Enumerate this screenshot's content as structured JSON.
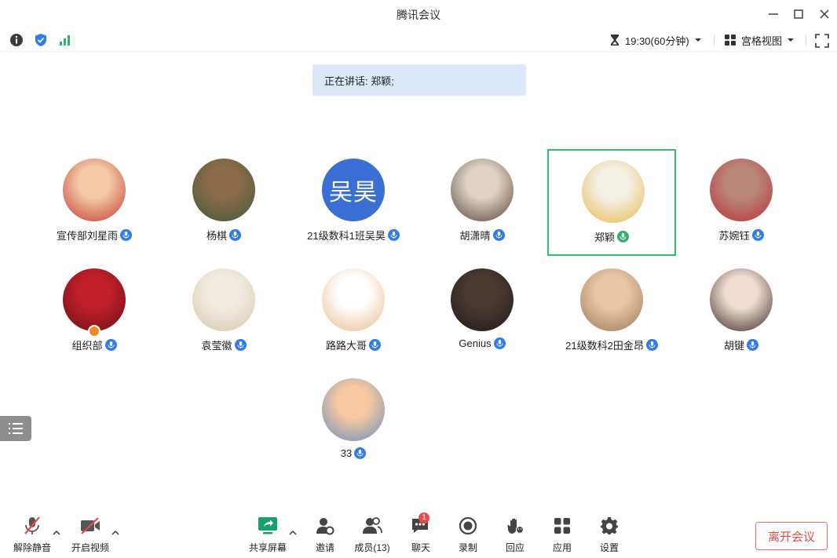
{
  "window": {
    "title": "腾讯会议"
  },
  "infobar": {
    "timer": "19:30(60分钟)",
    "view_label": "宫格视图"
  },
  "speaking_banner": "正在讲话: 郑颖;",
  "participants": [
    {
      "name": "宣传部刘星雨",
      "avatar_colors": [
        "#f3c9a8",
        "#c0392b"
      ]
    },
    {
      "name": "杨棋",
      "avatar_colors": [
        "#8b6b4a",
        "#3e5a3a"
      ]
    },
    {
      "name": "21级数科1班吴昊",
      "avatar_text": "吴昊"
    },
    {
      "name": "胡潇晴",
      "avatar_colors": [
        "#ddd2c4",
        "#5a4438"
      ]
    },
    {
      "name": "郑颖",
      "avatar_colors": [
        "#f3f0e6",
        "#e8b84a"
      ]
    },
    {
      "name": "苏婉钰",
      "avatar_colors": [
        "#b78778",
        "#c02f3a"
      ]
    },
    {
      "name": "组织部",
      "avatar_colors": [
        "#c0202a",
        "#6a0f14"
      ]
    },
    {
      "name": "袁莹徽",
      "avatar_colors": [
        "#f2ece2",
        "#d8c7a8"
      ]
    },
    {
      "name": "路路大哥",
      "avatar_colors": [
        "#ffffff",
        "#e6b98a"
      ]
    },
    {
      "name": "Genius",
      "avatar_colors": [
        "#4a3a32",
        "#1d1a1a"
      ]
    },
    {
      "name": "21级数科2田金昂",
      "avatar_colors": [
        "#e9c7a6",
        "#9a7a5c"
      ]
    },
    {
      "name": "胡键",
      "avatar_colors": [
        "#f0dcd2",
        "#3b2a26"
      ]
    },
    {
      "name": "33",
      "avatar_colors": [
        "#f6c9a0",
        "#6a8fbf"
      ]
    }
  ],
  "active_speaker_index": 4,
  "toolbar": {
    "unmute": "解除静音",
    "start_video": "开启视频",
    "share_screen": "共享屏幕",
    "invite": "邀请",
    "members": "成员(13)",
    "chat": "聊天",
    "chat_badge": "1",
    "record": "录制",
    "reactions": "回应",
    "apps": "应用",
    "settings": "设置",
    "leave": "离开会议"
  },
  "colors": {
    "accent_blue": "#2f7bf0",
    "active_border": "#2fc06c",
    "leave_red": "#e84a4a",
    "mic_off_red": "#e84a4a",
    "share_green": "#16a36b",
    "banner_bg": "#dce8fa"
  }
}
